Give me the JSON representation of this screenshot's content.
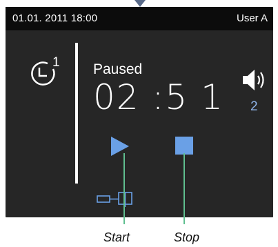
{
  "topbar": {
    "datetime": "01.01. 2011 18:00",
    "user": "User A"
  },
  "timer": {
    "program_number": "1",
    "status": "Paused",
    "time": "02 :5 1"
  },
  "volume": {
    "level": "2"
  },
  "callouts": {
    "start": "Start",
    "stop": "Stop"
  },
  "colors": {
    "accent": "#6aa0e6",
    "callout_line": "#5fbf8f",
    "screen_bg": "#262626"
  },
  "icons": {
    "timer": "clock-timer-icon",
    "volume": "speaker-volume-icon",
    "play": "play-icon",
    "stop": "stop-icon",
    "connector": "connector-icon"
  }
}
